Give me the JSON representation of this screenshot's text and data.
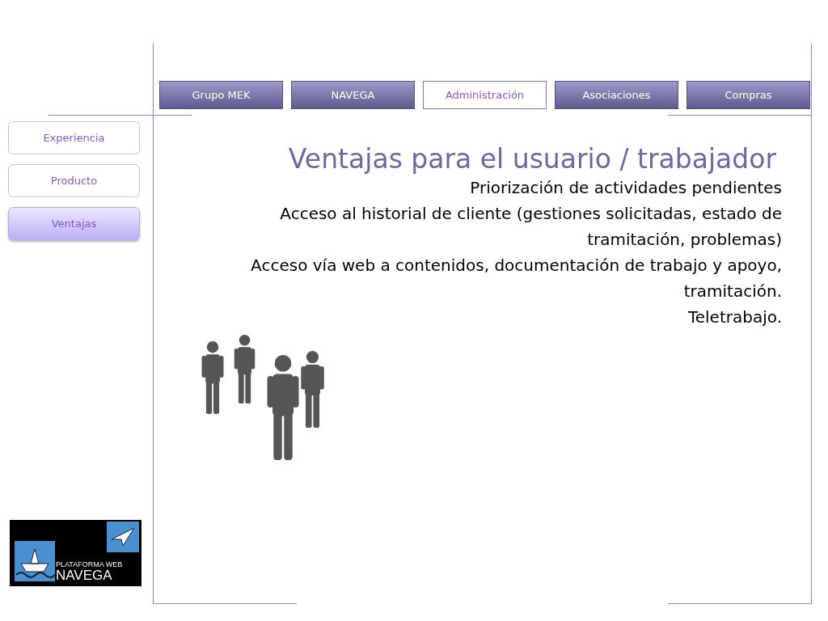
{
  "tabs": [
    {
      "label": "Grupo MEK",
      "selected": false
    },
    {
      "label": "NAVEGA",
      "selected": false
    },
    {
      "label": "Administración",
      "selected": true
    },
    {
      "label": "Asociaciones",
      "selected": false
    },
    {
      "label": "Compras",
      "selected": false
    }
  ],
  "sidebar": {
    "items": [
      {
        "label": "Experiencia",
        "selected": false
      },
      {
        "label": "Producto",
        "selected": false
      },
      {
        "label": "Ventajas",
        "selected": true
      }
    ]
  },
  "title": "Ventajas para el usuario / trabajador",
  "points": [
    "Priorización de actividades pendientes",
    "Acceso al historial de cliente (gestiones solicitadas, estado de tramitación, problemas)",
    "Acceso vía web a contenidos, documentación de trabajo y apoyo, tramitación.",
    "Teletrabajo."
  ],
  "logo": {
    "line1": "PLATAFORMA WEB",
    "line2": "NAVEGA"
  }
}
